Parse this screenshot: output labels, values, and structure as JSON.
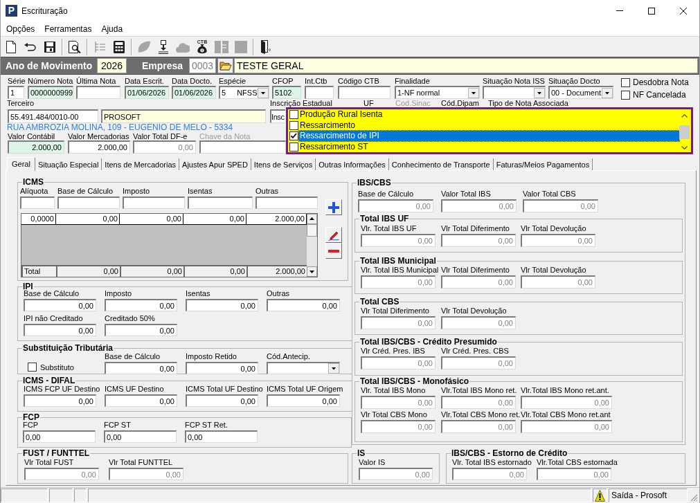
{
  "window": {
    "title": "Escrituração",
    "logo": "P"
  },
  "menu": [
    "Opções",
    "Ferramentas",
    "Ajuda"
  ],
  "toolbar": [
    [
      {
        "disabled": false
      },
      {
        "disabled": false
      },
      {
        "disabled": false
      }
    ],
    [
      {
        "disabled": false
      }
    ],
    [
      {
        "disabled": true
      },
      {
        "disabled": false
      }
    ],
    [
      {
        "disabled": true
      },
      {
        "disabled": false
      },
      {
        "disabled": true
      },
      {
        "disabled": false,
        "label": "CTB"
      },
      {
        "disabled": true
      },
      {
        "disabled": true
      }
    ],
    [
      {
        "disabled": false
      }
    ]
  ],
  "header": {
    "year": {
      "label": "Ano de Movimento",
      "value": "2026"
    },
    "company": {
      "label": "Empresa",
      "code": {
        "value": "0003",
        "disabled": true
      },
      "name": "TESTE GERAL"
    }
  },
  "document": {
    "fields": [
      {
        "label": "Série",
        "value": "1",
        "kind": "text",
        "highlighted": false
      },
      {
        "label": "Número Nota",
        "value": "0000000999",
        "kind": "text",
        "highlighted": true
      },
      {
        "label": "Última Nota",
        "kind": "text",
        "highlighted": false
      },
      {
        "label": "Data Escrit.",
        "value": "01/06/2026",
        "kind": "text",
        "highlighted": true
      },
      {
        "label": "Data Docto.",
        "value": "01/06/2026",
        "kind": "text",
        "highlighted": true
      },
      {
        "label": "Espécie",
        "code": "5",
        "value": "NFSS",
        "kind": "combo",
        "highlighted": false
      },
      {
        "label": "CFOP",
        "value": "5102",
        "kind": "text",
        "highlighted": true
      },
      {
        "label": "Int.Ctb",
        "kind": "text",
        "highlighted": false
      },
      {
        "label": "Código CTB",
        "kind": "text",
        "highlighted": false
      },
      {
        "label": "Finalidade",
        "value": "1-NF normal",
        "kind": "combo",
        "highlighted": false
      },
      {
        "label": "Situação Nota ISS",
        "kind": "combo",
        "highlighted": false
      },
      {
        "label": "Situação Docto",
        "value": "00 - Document",
        "kind": "combo",
        "highlighted": false
      }
    ],
    "options": [
      {
        "label": "Desdobra Nota",
        "checked": false
      },
      {
        "label": "NF Cancelada",
        "checked": false
      }
    ],
    "third_party": {
      "label": "Terceiro",
      "document": "55.491.484/0010-00",
      "name": "PROSOFT",
      "address": "RUA AMBROZIA MOLINA, 109 - EUGENIO DE MELO - 5334"
    },
    "state_registration": {
      "label": "Inscrição Estadual",
      "value": "Insc"
    },
    "more_labels": [
      {
        "label": "UF",
        "disabled": false
      },
      {
        "label": "Cod.Sinac",
        "disabled": true
      },
      {
        "label": "Cód.Dipam",
        "disabled": false
      },
      {
        "label": "Tipo de Nota Associada",
        "disabled": false
      }
    ],
    "values": [
      {
        "label": "Valor Contábil",
        "value": "2.000,00",
        "kind": "amount",
        "highlighted": true,
        "readonly": false,
        "disabled": false
      },
      {
        "label": "Valor Mercadorias",
        "value": "2.000,00",
        "kind": "amount",
        "highlighted": false,
        "readonly": false,
        "disabled": false
      },
      {
        "label": "Valor Total DF-e",
        "value": "0,00",
        "kind": "amount",
        "highlighted": false,
        "readonly": true,
        "disabled": false
      },
      {
        "label": "Chave da Nota",
        "kind": "text",
        "highlighted": false,
        "disabled": true
      }
    ]
  },
  "note_type_list": [
    {
      "label": "Produção Rural Isenta",
      "checked": false,
      "selected": false
    },
    {
      "label": "Ressarcimento",
      "checked": false,
      "selected": false
    },
    {
      "label": "Ressarcimento de IPI",
      "checked": true,
      "selected": true
    },
    {
      "label": "Ressarcimento ST",
      "checked": false,
      "selected": false
    }
  ],
  "tabs": [
    {
      "label": "Geral",
      "selected": true
    },
    {
      "label": "Situação Especial",
      "selected": false
    },
    {
      "label": "Itens de Mercadorias",
      "selected": false
    },
    {
      "label": "Ajustes Apur SPED",
      "selected": false
    },
    {
      "label": "Itens de Serviços",
      "selected": false
    },
    {
      "label": "Outras Informações",
      "selected": false
    },
    {
      "label": "Conhecimento de Transporte",
      "selected": false
    },
    {
      "label": "Faturas/Meios Pagamentos",
      "selected": false
    }
  ],
  "icms": {
    "title": "ICMS",
    "inputs": [
      {
        "label": "Alíquota"
      },
      {
        "label": "Base de Cálculo"
      },
      {
        "label": "Imposto"
      },
      {
        "label": "Isentas"
      },
      {
        "label": "Outras"
      }
    ],
    "rows": [
      [
        "0,0000",
        "0,00",
        "0,00",
        "0,00",
        "2.000,00"
      ]
    ],
    "total": [
      "Total",
      "0,00",
      "0,00",
      "0,00",
      "2.000,00"
    ]
  },
  "left_groups": [
    {
      "title": "IPI",
      "rows": [
        [
          {
            "label": "Base de Cálculo",
            "value": "0,00",
            "kind": "amount",
            "readonly": false
          },
          {
            "label": "Imposto",
            "value": "0,00",
            "kind": "amount",
            "readonly": false
          },
          {
            "label": "Isentas",
            "value": "0,00",
            "kind": "amount",
            "readonly": false
          },
          {
            "label": "Outras",
            "value": "0,00",
            "kind": "amount",
            "readonly": false
          }
        ],
        [
          {
            "label": "IPI não Creditado",
            "value": "0,00",
            "kind": "amount",
            "readonly": false
          },
          {
            "label": "Creditado 50%",
            "value": "0,00",
            "kind": "amount",
            "readonly": false
          }
        ]
      ]
    },
    {
      "title": "Substituição Tributária",
      "rows": [
        [
          {
            "label": "Substituto",
            "kind": "checkbox",
            "checked": false
          },
          {
            "label": "Base de Cálculo",
            "value": "0,00",
            "kind": "amount",
            "readonly": false
          },
          {
            "label": "Imposto Retido",
            "value": "0,00",
            "kind": "amount",
            "readonly": false
          },
          {
            "label": "Cód.Antecip.",
            "kind": "combo"
          }
        ]
      ]
    },
    {
      "title": "ICMS - DIFAL",
      "rows": [
        [
          {
            "label": "ICMS FCP UF Destino",
            "value": "0,00",
            "kind": "amount",
            "readonly": false
          },
          {
            "label": "ICMS UF Destino",
            "value": "0,00",
            "kind": "amount",
            "readonly": false
          },
          {
            "label": "ICMS Total UF Destino",
            "value": "0,00",
            "kind": "amount",
            "readonly": false
          },
          {
            "label": "ICMS Total UF Origem",
            "value": "0,00",
            "kind": "amount",
            "readonly": false
          }
        ]
      ]
    },
    {
      "title": "FCP",
      "rows": [
        [
          {
            "label": "FCP",
            "value": "0,00",
            "kind": "text",
            "readonly": false
          },
          {
            "label": "FCP ST",
            "value": "0,00",
            "kind": "text",
            "readonly": false
          },
          {
            "label": "FCP ST Ret.",
            "value": "0,00",
            "kind": "text",
            "readonly": false
          }
        ]
      ]
    },
    {
      "title": "FUST / FUNTTEL",
      "rows": [
        [
          {
            "label": "Vlr Total FUST",
            "value": "0,00",
            "kind": "amount",
            "readonly": true
          },
          {
            "label": "Vlr Total FUNTTEL",
            "value": "0,00",
            "kind": "amount",
            "readonly": true
          }
        ]
      ]
    }
  ],
  "ibs_cbs": {
    "title": "IBS/CBS",
    "fields": [
      {
        "label": "Base de Cálculo",
        "value": "0,00",
        "kind": "amount",
        "readonly": true
      },
      {
        "label": "Valor Total IBS",
        "value": "0,00",
        "kind": "amount",
        "readonly": true
      },
      {
        "label": "Valor Total CBS",
        "value": "0,00",
        "kind": "amount",
        "readonly": true
      }
    ],
    "subgroups": [
      {
        "title": "Total IBS UF",
        "rows": [
          [
            {
              "label": "Vlr. Total IBS UF",
              "value": "0,00",
              "kind": "amount",
              "readonly": true
            },
            {
              "label": "Vlr Total Diferimento",
              "value": "0,00",
              "kind": "amount",
              "readonly": true
            },
            {
              "label": "Vlr Total Devolução",
              "value": "0,00",
              "kind": "amount",
              "readonly": true
            }
          ]
        ]
      },
      {
        "title": "Total IBS Municipal",
        "rows": [
          [
            {
              "label": "Vlr. Total IBS Municipal",
              "value": "0,00",
              "kind": "amount",
              "readonly": true
            },
            {
              "label": "Vlr Total Diferimento",
              "value": "0,00",
              "kind": "amount",
              "readonly": true
            },
            {
              "label": "Vlr Total Devolução",
              "value": "0,00",
              "kind": "amount",
              "readonly": true
            }
          ]
        ]
      },
      {
        "title": "Total CBS",
        "rows": [
          [
            {
              "label": "Vlr Total Diferimento",
              "value": "0,00",
              "kind": "amount",
              "readonly": true
            },
            {
              "label": "Vlr Total Devolução",
              "value": "0,00",
              "kind": "amount",
              "readonly": true
            }
          ]
        ]
      },
      {
        "title": "Total IBS/CBS - Crédito Presumido",
        "rows": [
          [
            {
              "label": "Vlr Créd. Pres. IBS",
              "value": "0,00",
              "kind": "amount",
              "readonly": true
            },
            {
              "label": "Vlr Créd. Pres. CBS",
              "value": "0,00",
              "kind": "amount",
              "readonly": true
            }
          ]
        ]
      },
      {
        "title": "Total IBS/CBS - Monofásico",
        "rows": [
          [
            {
              "label": "Vlr. Total IBS Mono",
              "value": "0,00",
              "kind": "amount",
              "readonly": true
            },
            {
              "label": "Vlr.Total IBS Mono ret.",
              "value": "0,00",
              "kind": "amount",
              "readonly": true
            },
            {
              "label": "Vlr.Total IBS Mono ret.ant.",
              "value": "0,00",
              "kind": "amount",
              "readonly": true
            }
          ],
          [
            {
              "label": "Vlr Total CBS Mono",
              "value": "0,00",
              "kind": "amount",
              "readonly": true
            },
            {
              "label": "Vlr.Total CBS Mono ret.",
              "value": "0,00",
              "kind": "amount",
              "readonly": true
            },
            {
              "label": "Vlr.Total CBS Mono ret.ant",
              "value": "0,00",
              "kind": "amount",
              "readonly": true
            }
          ]
        ]
      }
    ]
  },
  "bottom_groups": [
    {
      "title": "IS",
      "rows": [
        [
          {
            "label": "Valor IS",
            "value": "0,00",
            "kind": "amount",
            "readonly": true
          }
        ]
      ]
    },
    {
      "title": "IBS/CBS - Estorno de Crédito",
      "rows": [
        [
          {
            "label": "Vlr. Total IBS estornado",
            "value": "0,00",
            "kind": "amount",
            "readonly": true
          },
          {
            "label": "Vlr.Total CBS estornada",
            "value": "0,00",
            "kind": "amount",
            "readonly": true
          }
        ]
      ]
    }
  ],
  "status_bar": {
    "text": "Saída - Prosoft"
  }
}
